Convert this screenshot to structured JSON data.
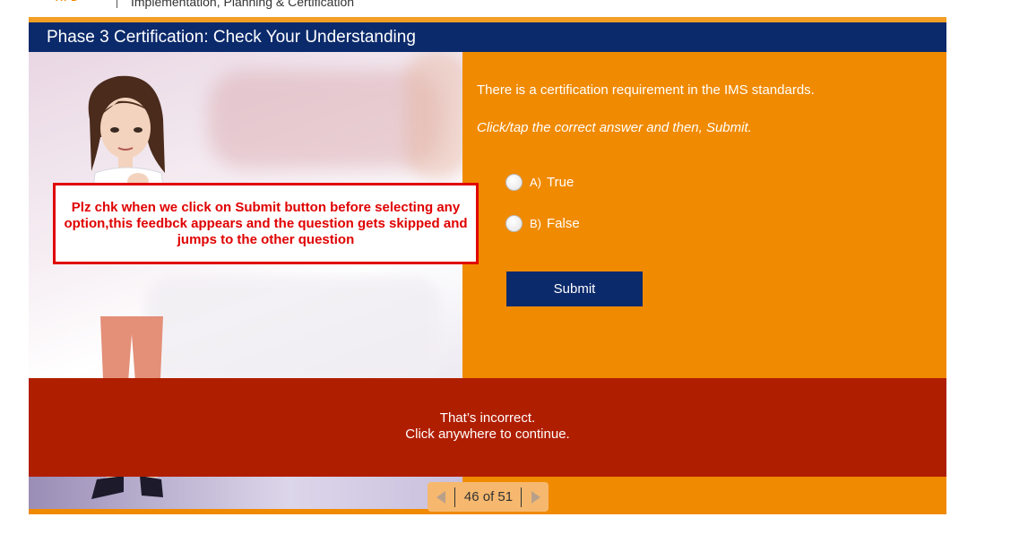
{
  "app": {
    "logo_text": "APD",
    "program_title": "Implementation, Planning & Certification"
  },
  "slide": {
    "title": "Phase 3 Certification: Check Your Understanding"
  },
  "quiz": {
    "question": "There is a certification requirement in the IMS standards.",
    "instruction": "Click/tap the correct answer and then, Submit.",
    "options": [
      {
        "letter": "A)",
        "text": "True",
        "selected": false
      },
      {
        "letter": "B)",
        "text": "False",
        "selected": false
      }
    ],
    "submit_label": "Submit"
  },
  "feedback": {
    "line1": "That’s incorrect.",
    "line2": "Click anywhere to continue."
  },
  "navigation": {
    "page_indicator": "46 of 51",
    "prev_icon": "triangle-left-icon",
    "next_icon": "triangle-right-icon"
  },
  "annotation": {
    "text": "Plz chk when we click on Submit button before selecting any option,this feedbck appears and the question gets skipped and jumps to the other question"
  },
  "colors": {
    "header_navy": "#0b2a6b",
    "panel_orange": "#f08a00",
    "feedback_red": "#b01e00",
    "annotation_red": "#e00000"
  }
}
